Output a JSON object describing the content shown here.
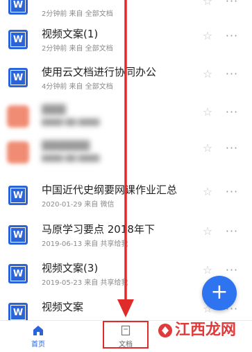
{
  "documents": [
    {
      "title": "",
      "meta": "2分钟前  来自 全部文档",
      "blurred": false
    },
    {
      "title": "视频文案(1)",
      "meta": "2分钟前  来自 全部文档",
      "blurred": false
    },
    {
      "title": "使用云文档进行协同办公",
      "meta": "4分钟前  来自 全部文档",
      "blurred": false
    },
    {
      "title": "",
      "meta": "",
      "blurred": true
    },
    {
      "title": "",
      "meta": "",
      "blurred": true
    },
    {
      "title": "中国近代史纲要网课作业汇总",
      "meta": "2020-01-29  来自 微信",
      "blurred": false
    },
    {
      "title": "马原学习要点 2018年下",
      "meta": "2019-06-13  来自 共享给我",
      "blurred": false
    },
    {
      "title": "视频文案(3)",
      "meta": "2019-05-23  来自 共享给我",
      "blurred": false
    },
    {
      "title": "视频文案",
      "meta": "",
      "blurred": false
    }
  ],
  "icons": {
    "doc": "word-doc-icon",
    "star": "star-icon",
    "more": "more-icon",
    "fab": "plus-icon"
  },
  "fab": {
    "symbol": "+"
  },
  "doc_icon_letter": "W",
  "tabbar": {
    "home_label": "首页",
    "docs_label": "文档"
  },
  "watermark": {
    "text": "江西龙网"
  },
  "colors": {
    "accent": "#2b63d9",
    "fab": "#2e73f0",
    "annotation": "#e02b2b"
  }
}
